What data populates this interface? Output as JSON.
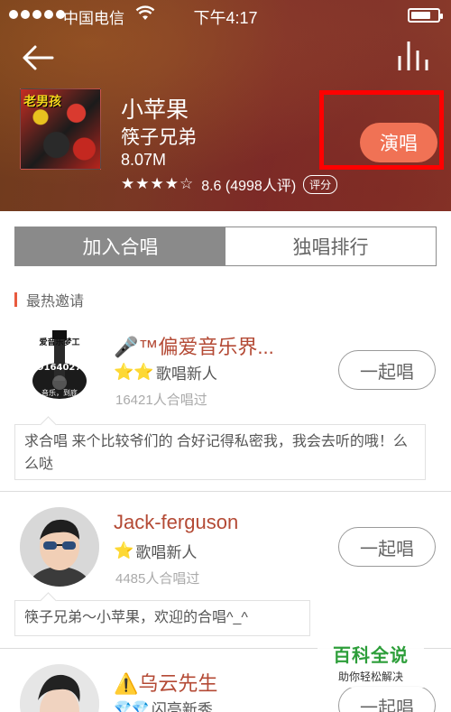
{
  "status_bar": {
    "carrier": "中国电信",
    "time": "下午4:17",
    "battery_level": 0.75
  },
  "header": {
    "back_icon": "back-arrow-icon",
    "chart_icon": "bar-chart-icon",
    "album_title": "老男孩",
    "song_title": "小苹果",
    "artist": "筷子兄弟",
    "file_size": "8.07M",
    "stars": "★★★★☆",
    "rating": 4,
    "score_text": "8.6 (4998人评)",
    "rate_label": "评分",
    "sing_label": "演唱",
    "highlight_color": "#ff0000",
    "sing_button_color": "#f07255"
  },
  "tabs": [
    {
      "label": "加入合唱",
      "active": true
    },
    {
      "label": "独唱排行",
      "active": false
    }
  ],
  "section": {
    "title": "最热邀请",
    "accent_color": "#e85a3e"
  },
  "invites": [
    {
      "name": "🎤™偏爱音乐界...",
      "level_icons": "⭐⭐",
      "level": "歌唱新人",
      "count": "16421人合唱过",
      "join_label": "一起唱",
      "message": "求合唱 来个比较爷们的 合好记得私密我，我会去听的哦！么么哒",
      "avatar_text": "爱音乐梦工\n9164027\n音乐，到底"
    },
    {
      "name": "Jack-ferguson",
      "level_icons": "⭐",
      "level": "歌唱新人",
      "count": "4485人合唱过",
      "join_label": "一起唱",
      "message": "筷子兄弟～小苹果，欢迎的合唱^_^"
    },
    {
      "name": "⚠️乌云先生",
      "level_icons": "💎💎",
      "level": "闪亮新秀",
      "join_label": "一起唱"
    }
  ],
  "watermark": {
    "main": "百科全说",
    "sub": "助你轻松解决"
  }
}
